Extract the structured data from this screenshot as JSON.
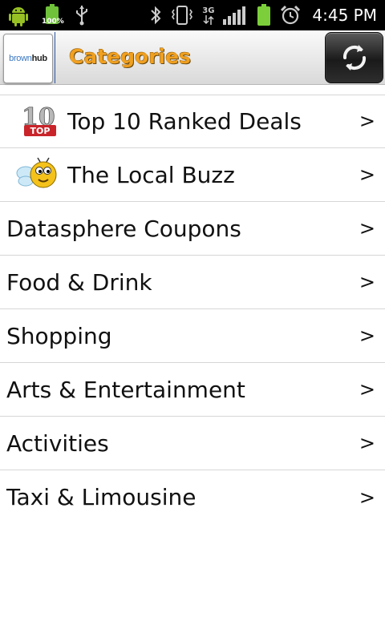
{
  "status_bar": {
    "battery_small_label": "100%",
    "time": "4:45 PM",
    "network_label": "3G"
  },
  "header": {
    "logo_text_1": "brown",
    "logo_text_2": "hub",
    "title": "Categories",
    "title_color": "#f0a020"
  },
  "categories": [
    {
      "label": "Top 10 Ranked Deals",
      "icon": "top10-icon",
      "arrow": ">"
    },
    {
      "label": "The Local Buzz",
      "icon": "bee-icon",
      "arrow": ">"
    },
    {
      "label": "Datasphere Coupons",
      "icon": null,
      "arrow": ">"
    },
    {
      "label": "Food & Drink",
      "icon": null,
      "arrow": ">"
    },
    {
      "label": "Shopping",
      "icon": null,
      "arrow": ">"
    },
    {
      "label": "Arts & Entertainment",
      "icon": null,
      "arrow": ">"
    },
    {
      "label": "Activities",
      "icon": null,
      "arrow": ">"
    },
    {
      "label": "Taxi & Limousine",
      "icon": null,
      "arrow": ">"
    }
  ]
}
